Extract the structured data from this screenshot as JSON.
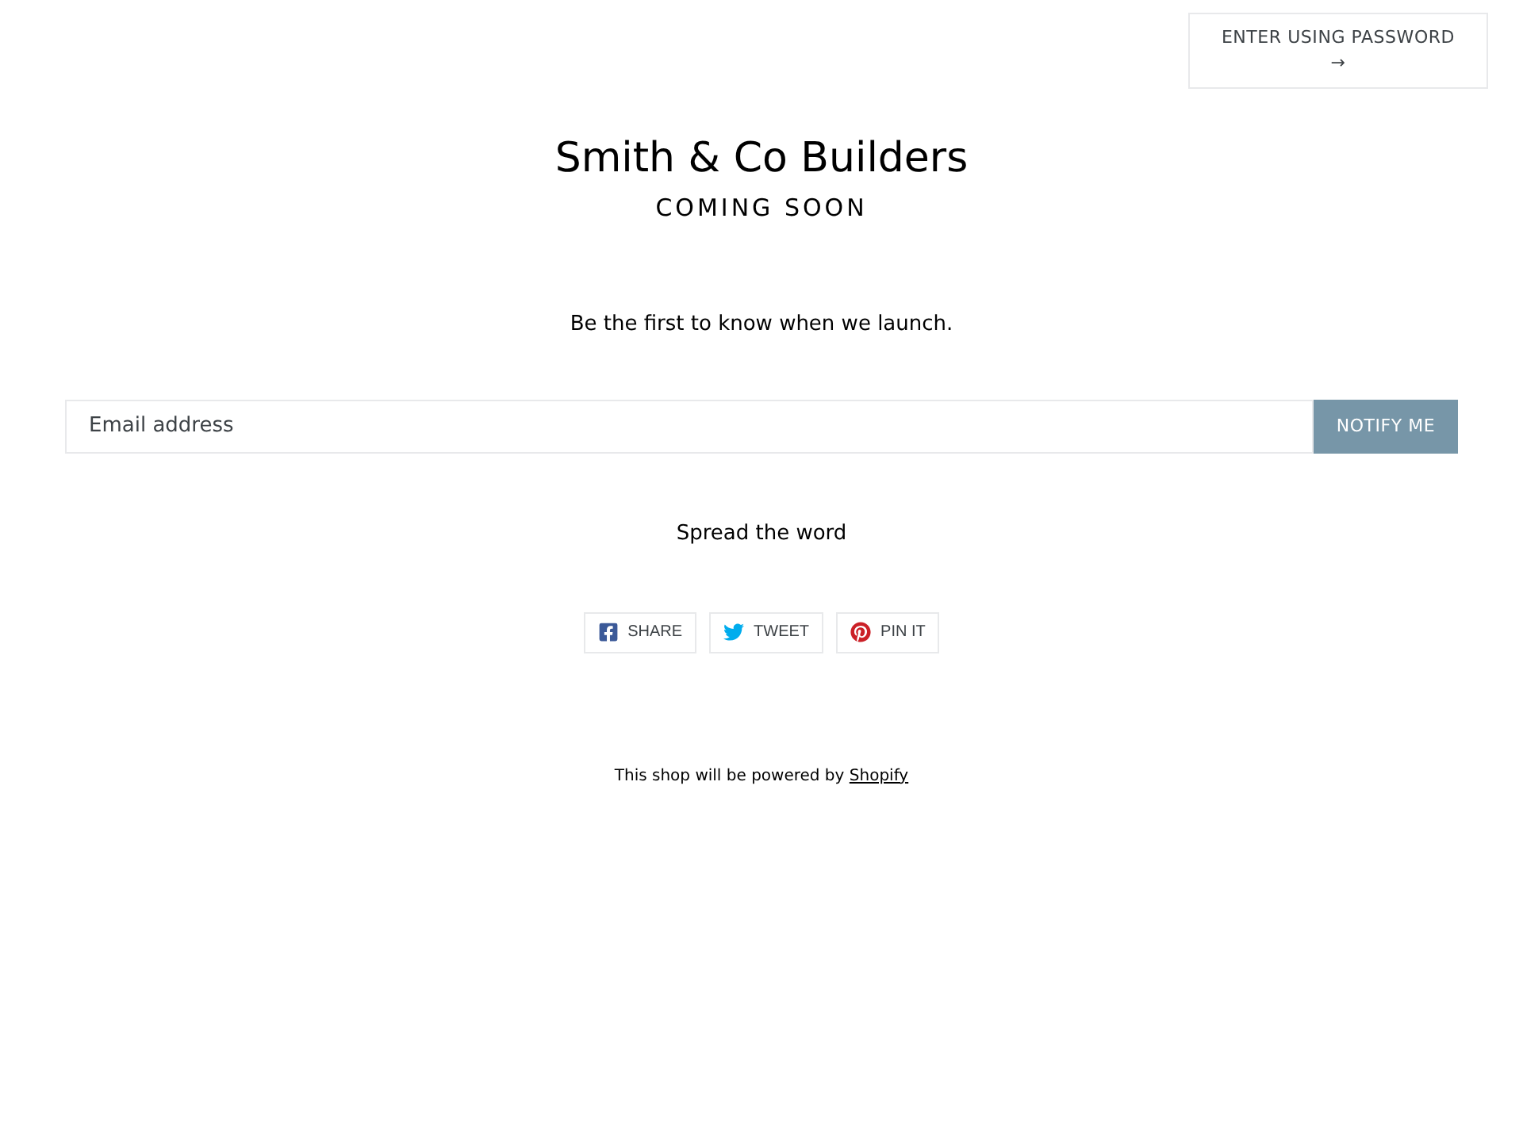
{
  "password_button": {
    "label": "ENTER USING PASSWORD",
    "arrow": "→"
  },
  "header": {
    "title": "Smith & Co Builders",
    "subtitle": "COMING SOON"
  },
  "intro": "Be the first to know when we launch.",
  "signup": {
    "placeholder": "Email address",
    "button": "NOTIFY ME"
  },
  "share_heading": "Spread the word",
  "share_buttons": [
    {
      "kind": "facebook",
      "label": "SHARE"
    },
    {
      "kind": "twitter",
      "label": "TWEET"
    },
    {
      "kind": "pinterest",
      "label": "PIN IT"
    }
  ],
  "footer": {
    "text": "This shop will be powered by",
    "link": "Shopify"
  }
}
